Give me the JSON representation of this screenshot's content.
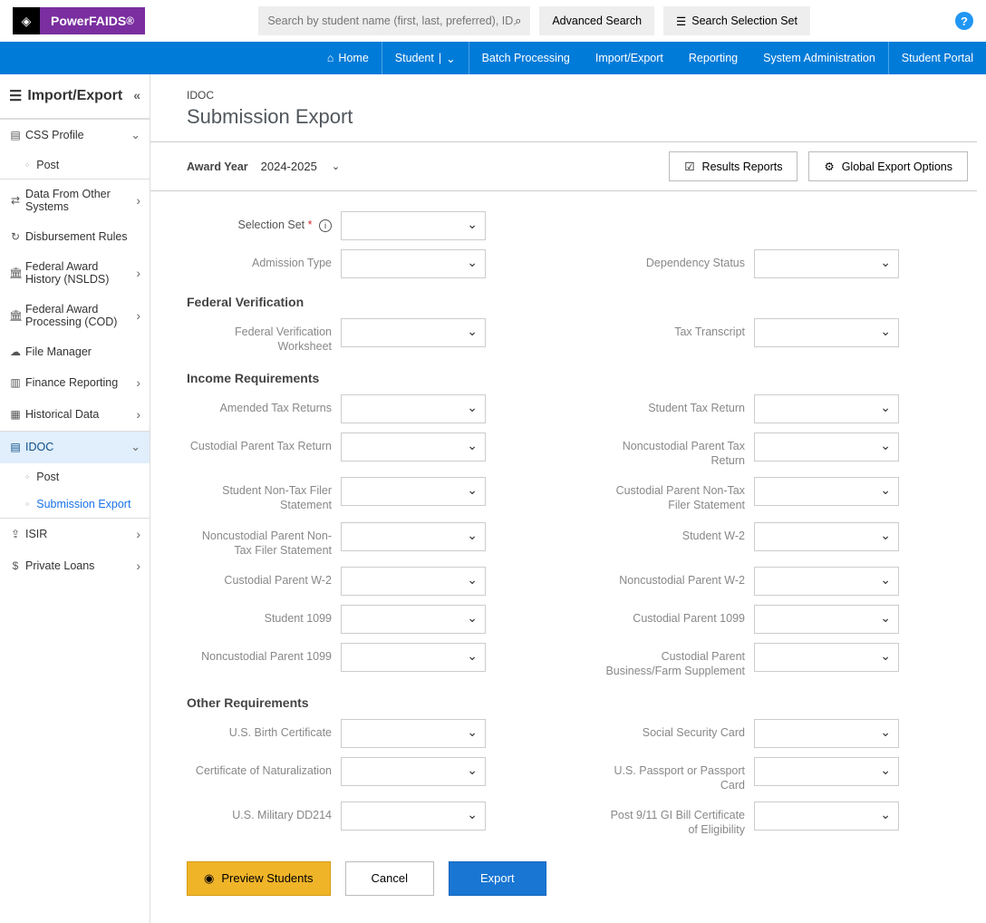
{
  "brand": {
    "name": "PowerFAIDS",
    "superscript": "®"
  },
  "search": {
    "placeholder": "Search by student name (first, last, preferred), ID, or SSN"
  },
  "topButtons": {
    "advanced": "Advanced Search",
    "selectionSet": "Search Selection Set"
  },
  "nav": {
    "home": "Home",
    "student": "Student",
    "batch": "Batch Processing",
    "importExport": "Import/Export",
    "reporting": "Reporting",
    "sysadmin": "System Administration",
    "portal": "Student Portal"
  },
  "sidebar": {
    "title": "Import/Export",
    "items": {
      "css": "CSS Profile",
      "cssPost": "Post",
      "dataFrom": "Data From Other Systems",
      "disb": "Disbursement Rules",
      "nslds": "Federal Award History (NSLDS)",
      "cod": "Federal Award Processing (COD)",
      "fileMgr": "File Manager",
      "finance": "Finance Reporting",
      "hist": "Historical Data",
      "idoc": "IDOC",
      "idocPost": "Post",
      "idocSub": "Submission Export",
      "isir": "ISIR",
      "privLoans": "Private Loans"
    }
  },
  "page": {
    "breadcrumb": "IDOC",
    "title": "Submission Export",
    "awardYearLabel": "Award Year",
    "awardYearValue": "2024-2025",
    "resultsReports": "Results Reports",
    "globalExport": "Global Export Options"
  },
  "form": {
    "selectionSet": "Selection Set",
    "admissionType": "Admission Type",
    "dependencyStatus": "Dependency Status",
    "sections": {
      "fedVer": "Federal Verification",
      "income": "Income Requirements",
      "other": "Other Requirements"
    },
    "fedVerWorksheet": "Federal Verification Worksheet",
    "taxTranscript": "Tax Transcript",
    "amendedTax": "Amended Tax Returns",
    "studentTax": "Student Tax Return",
    "custParentTax": "Custodial Parent Tax Return",
    "noncustParentTax": "Noncustodial Parent Tax Return",
    "studentNonTax": "Student Non-Tax Filer Statement",
    "custNonTax": "Custodial Parent Non-Tax Filer Statement",
    "noncustNonTax": "Noncustodial Parent Non-Tax Filer Statement",
    "studentW2": "Student W-2",
    "custW2": "Custodial Parent W-2",
    "noncustW2": "Noncustodial Parent W-2",
    "student1099": "Student 1099",
    "cust1099": "Custodial Parent 1099",
    "noncust1099": "Noncustodial Parent 1099",
    "custBizFarm": "Custodial Parent Business/Farm Supplement",
    "birthCert": "U.S. Birth Certificate",
    "ssCard": "Social Security Card",
    "certNat": "Certificate of Naturalization",
    "passport": "U.S. Passport or Passport Card",
    "dd214": "U.S. Military DD214",
    "giBill": "Post 9/11 GI Bill Certificate of Eligibility"
  },
  "actions": {
    "preview": "Preview Students",
    "cancel": "Cancel",
    "export": "Export"
  }
}
